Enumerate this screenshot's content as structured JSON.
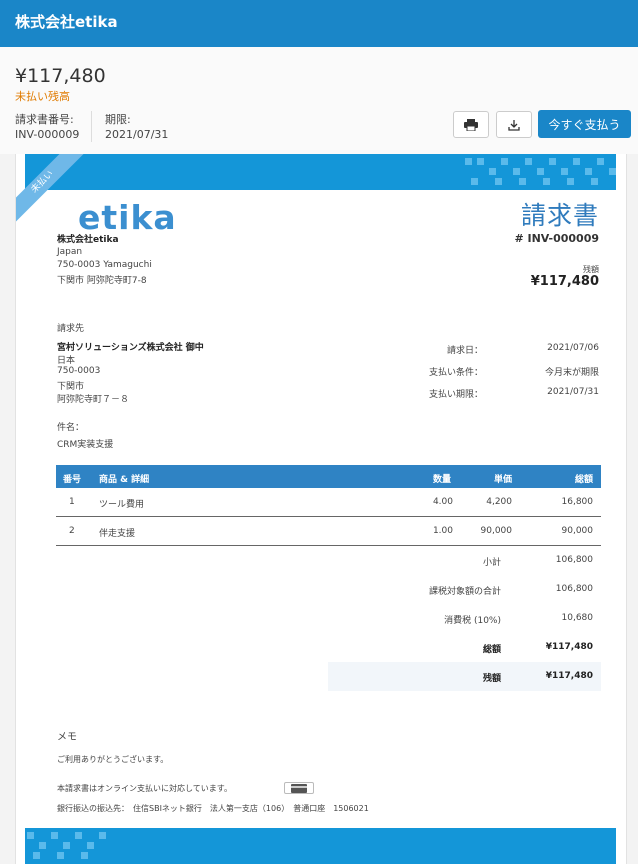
{
  "topbar": {
    "company_name": "株式会社etika"
  },
  "summary": {
    "amount": "¥117,480",
    "status": "未払い残高",
    "invoice_number_label": "請求書番号:",
    "invoice_number": "INV-000009",
    "due_label": "期限:",
    "due_date": "2021/07/31",
    "pay_button": "今すぐ支払う",
    "print_icon": "printer-icon",
    "download_icon": "download-icon"
  },
  "invoice": {
    "ribbon": "未払い",
    "logo_text": "etika",
    "doc_title": "請求書",
    "doc_number": "# INV-000009",
    "balance_label": "残額",
    "balance_value": "¥117,480",
    "seller": {
      "name": "株式会社etika",
      "country": "Japan",
      "postal": "750-0003 Yamaguchi",
      "address": "下関市 阿弥陀寺町7-8"
    },
    "bill_to_label": "請求先",
    "buyer": {
      "name": "宮村ソリューションズ株式会社 御中",
      "country": "日本",
      "postal": "750-0003",
      "city": "下関市",
      "address": "阿弥陀寺町７－８"
    },
    "meta": {
      "date_label": "請求日：",
      "date_value": "2021/07/06",
      "terms_label": "支払い条件：",
      "terms_value": "今月末が期限",
      "due_label": "支払い期限：",
      "due_value": "2021/07/31"
    },
    "subject_label": "件名：",
    "subject_value": "CRM実装支援",
    "table": {
      "headers": {
        "no": "番号",
        "item": "商品 & 詳細",
        "qty": "数量",
        "rate": "単価",
        "amount": "総額"
      },
      "rows": [
        {
          "no": "1",
          "item": "ツール費用",
          "qty": "4.00",
          "rate": "4,200",
          "amount": "16,800"
        },
        {
          "no": "2",
          "item": "伴走支援",
          "qty": "1.00",
          "rate": "90,000",
          "amount": "90,000"
        }
      ]
    },
    "totals": {
      "subtotal_label": "小計",
      "subtotal_value": "106,800",
      "taxable_label": "課税対象額の合計",
      "taxable_value": "106,800",
      "tax_label": "消費税 (10%)",
      "tax_value": "10,680",
      "total_label": "総額",
      "total_value": "¥117,480",
      "balance_label": "残額",
      "balance_value": "¥117,480"
    },
    "notes_label": "メモ",
    "notes_text": "ご利用ありがとうございます。",
    "online_text": "本請求書はオンライン支払いに対応しています。",
    "card_icon": "credit-card-icon",
    "bank_text": "銀行振込の振込先：　住信SBIネット銀行　法人第一支店（106）　普通口座　1506021"
  },
  "colors": {
    "brand": "#1a86c8",
    "accent": "#e07b00",
    "table_header": "#2f83c4"
  }
}
